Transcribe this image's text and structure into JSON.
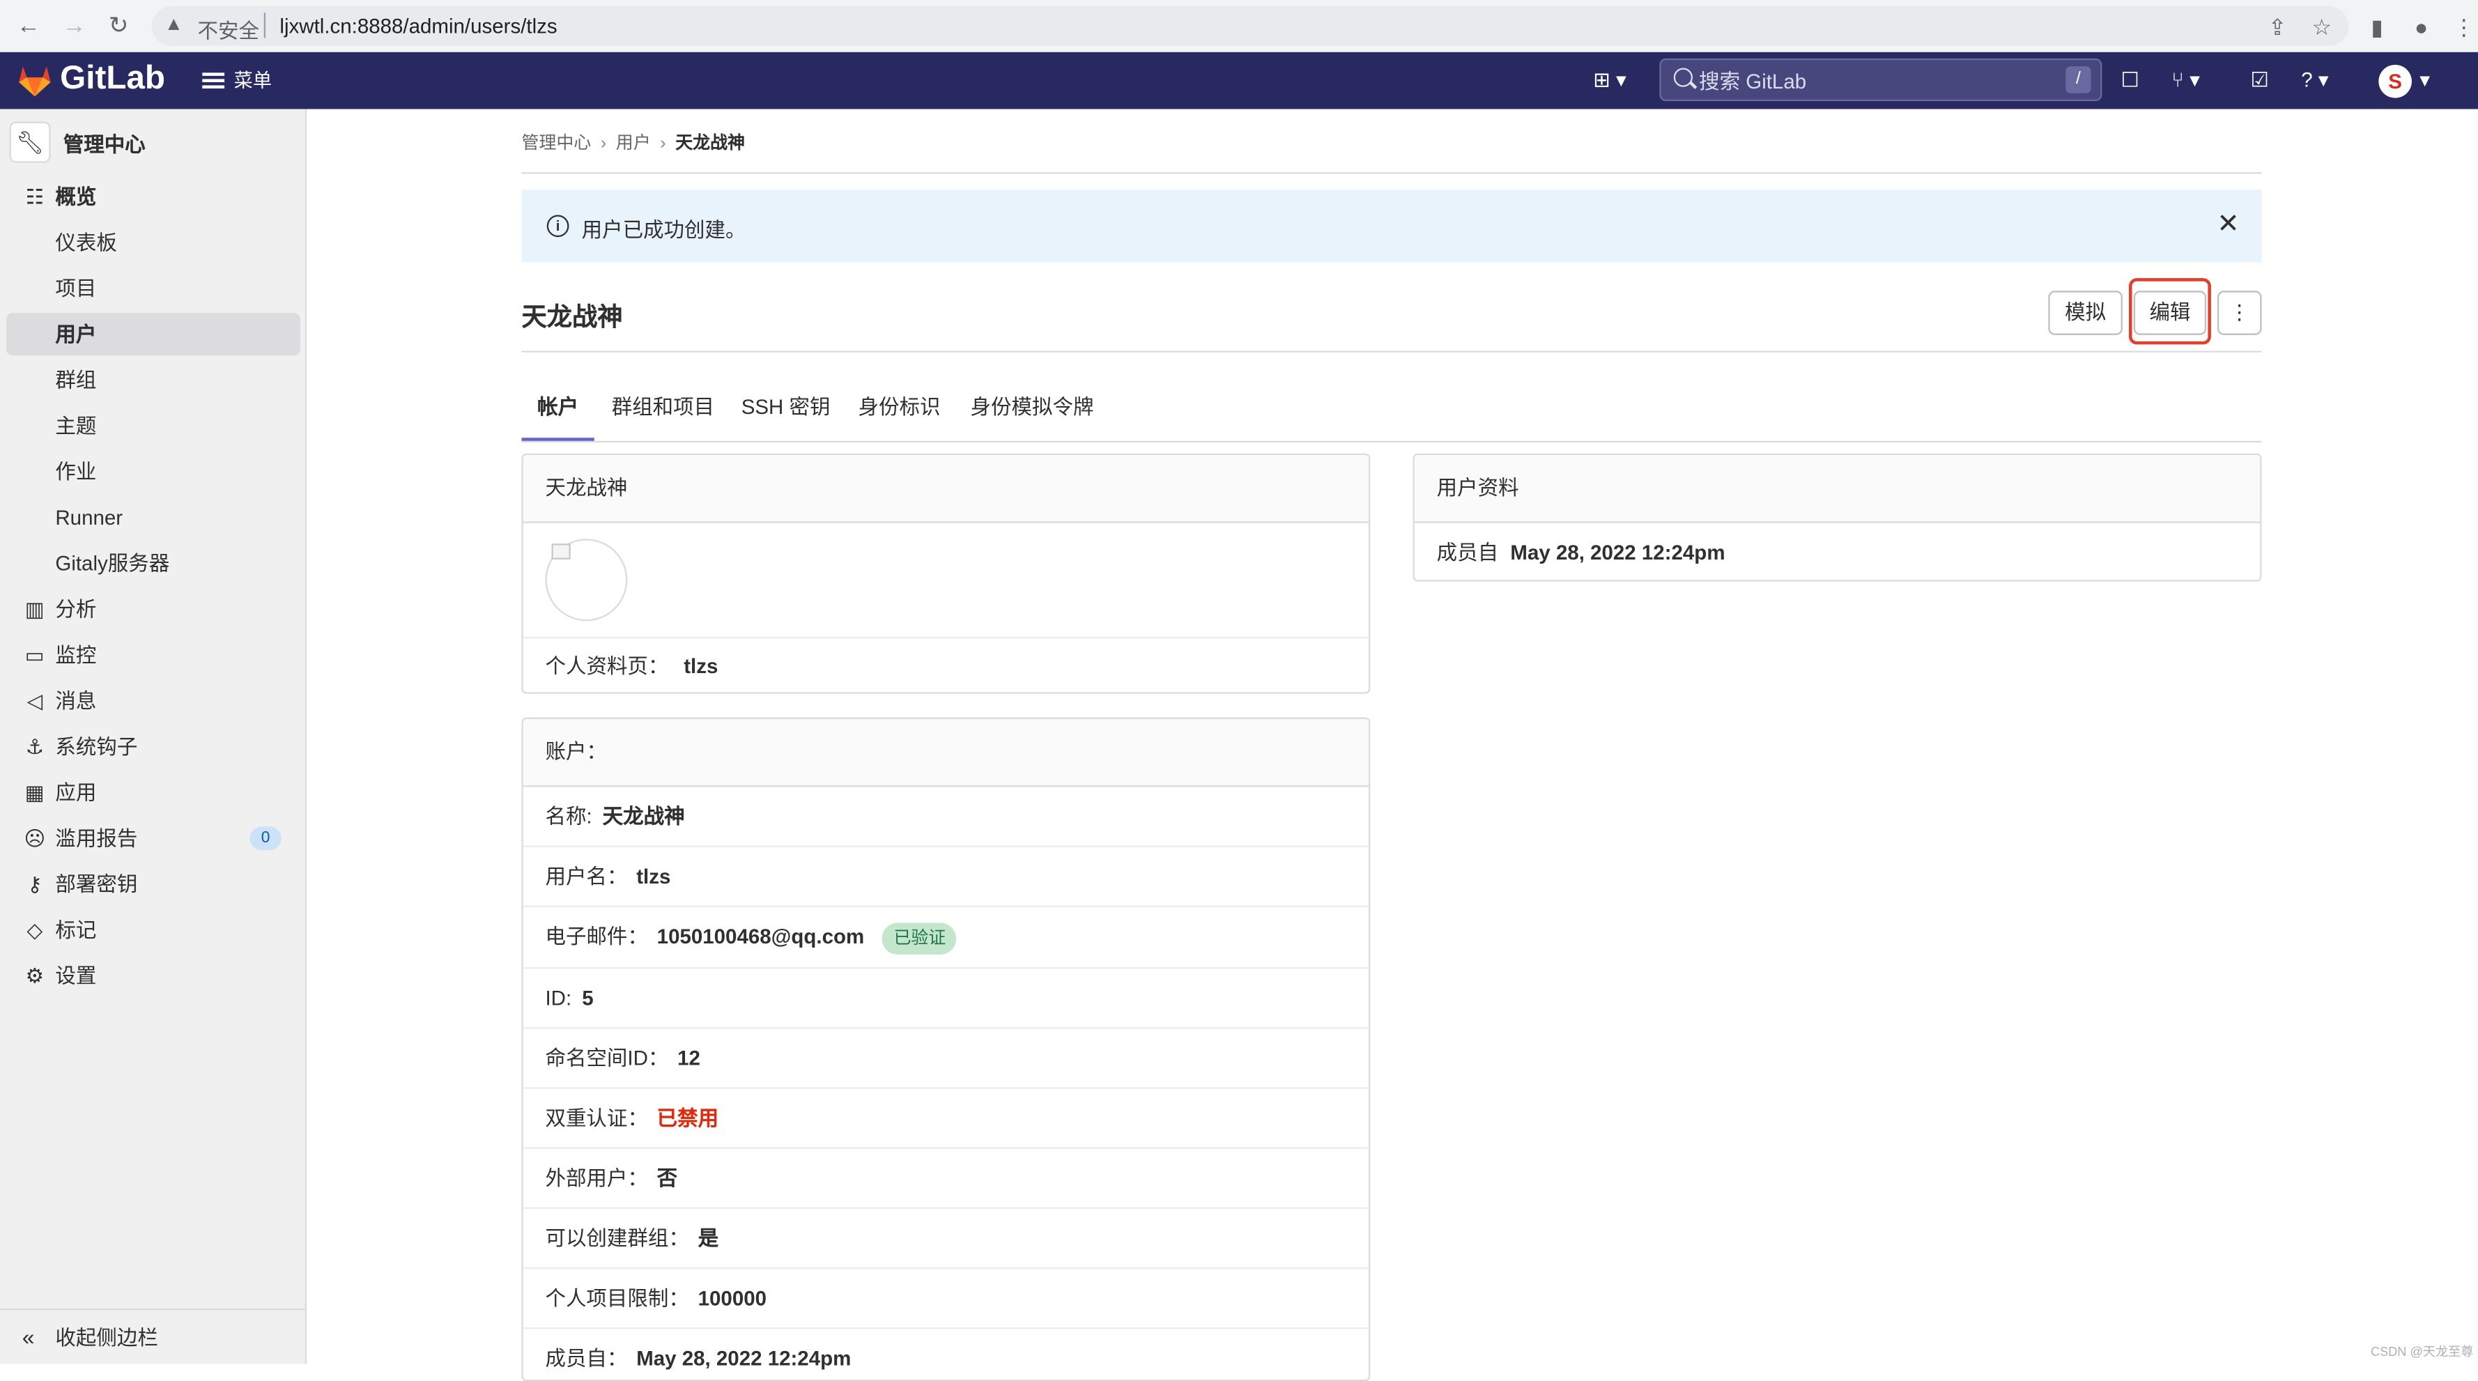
{
  "browser": {
    "security_label": "不安全",
    "url": "ljxwtl.cn:8888/admin/users/tlzs"
  },
  "header": {
    "brand": "GitLab",
    "menu_label": "菜单",
    "search_placeholder": "搜索 GitLab",
    "search_shortcut": "/",
    "avatar_initial": "S"
  },
  "sidebar": {
    "context_title": "管理中心",
    "items": [
      {
        "label": "概览",
        "icon": "overview-icon"
      },
      {
        "label": "仪表板"
      },
      {
        "label": "项目"
      },
      {
        "label": "用户"
      },
      {
        "label": "群组"
      },
      {
        "label": "主题"
      },
      {
        "label": "作业"
      },
      {
        "label": "Runner"
      },
      {
        "label": "Gitaly服务器"
      },
      {
        "label": "分析",
        "icon": "chart-icon"
      },
      {
        "label": "监控",
        "icon": "monitor-icon"
      },
      {
        "label": "消息",
        "icon": "bullhorn-icon"
      },
      {
        "label": "系统钩子",
        "icon": "anchor-icon"
      },
      {
        "label": "应用",
        "icon": "apps-icon"
      },
      {
        "label": "滥用报告",
        "icon": "abuse-icon",
        "badge": "0"
      },
      {
        "label": "部署密钥",
        "icon": "key-icon"
      },
      {
        "label": "标记",
        "icon": "label-icon"
      },
      {
        "label": "设置",
        "icon": "settings-icon"
      }
    ],
    "collapse_label": "收起侧边栏"
  },
  "breadcrumb": [
    "管理中心",
    "用户",
    "天龙战神"
  ],
  "alert": {
    "message": "用户已成功创建。"
  },
  "page": {
    "title": "天龙战神",
    "impersonate_label": "模拟",
    "edit_label": "编辑"
  },
  "tabs": [
    "帐户",
    "群组和项目",
    "SSH 密钥",
    "身份标识",
    "身份模拟令牌"
  ],
  "profile_card": {
    "title": "天龙战神",
    "profile_page_label": "个人资料页：",
    "profile_page_value": "tlzs"
  },
  "account_card": {
    "title": "账户：",
    "name_label": "名称:",
    "name_value": "天龙战神",
    "username_label": "用户名：",
    "username_value": "tlzs",
    "email_label": "电子邮件：",
    "email_value": "1050100468@qq.com",
    "email_badge": "已验证",
    "id_label": "ID:",
    "id_value": "5",
    "namespace_label": "命名空间ID：",
    "namespace_value": "12",
    "twofa_label": "双重认证：",
    "twofa_value": "已禁用",
    "external_label": "外部用户：",
    "external_value": "否",
    "can_create_group_label": "可以创建群组：",
    "can_create_group_value": "是",
    "project_limit_label": "个人项目限制：",
    "project_limit_value": "100000",
    "member_since_label": "成员自：",
    "member_since_value": "May 28, 2022 12:24pm"
  },
  "user_info_card": {
    "title": "用户资料",
    "member_since_label": "成员自",
    "member_since_value": "May 28, 2022 12:24pm"
  },
  "watermark": "CSDN @天龙至尊",
  "colors": {
    "header_bg": "#292961",
    "alert_bg": "#e9f3fc",
    "danger": "#dd2b0e",
    "verified_bg": "#c3e6cd",
    "highlight": "#e0412e"
  }
}
